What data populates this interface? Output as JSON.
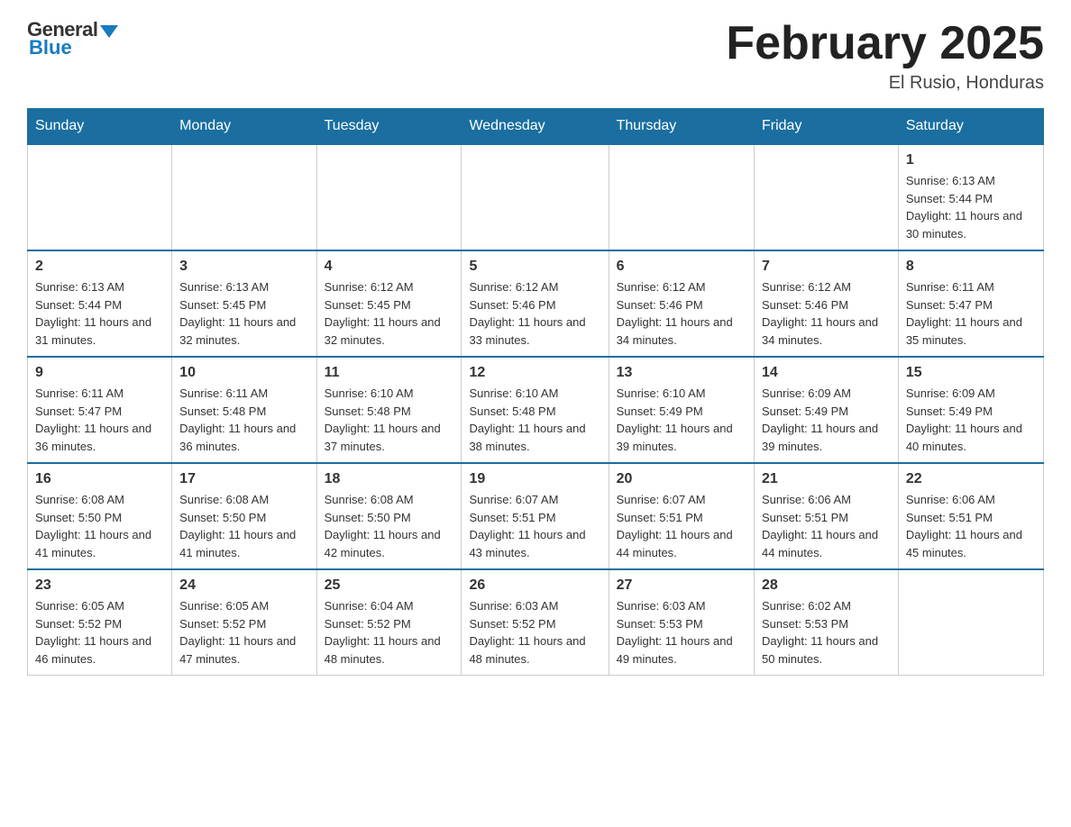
{
  "logo": {
    "general": "General",
    "blue": "Blue"
  },
  "title": "February 2025",
  "location": "El Rusio, Honduras",
  "days_of_week": [
    "Sunday",
    "Monday",
    "Tuesday",
    "Wednesday",
    "Thursday",
    "Friday",
    "Saturday"
  ],
  "weeks": [
    [
      {
        "day": "",
        "info": ""
      },
      {
        "day": "",
        "info": ""
      },
      {
        "day": "",
        "info": ""
      },
      {
        "day": "",
        "info": ""
      },
      {
        "day": "",
        "info": ""
      },
      {
        "day": "",
        "info": ""
      },
      {
        "day": "1",
        "info": "Sunrise: 6:13 AM\nSunset: 5:44 PM\nDaylight: 11 hours and 30 minutes."
      }
    ],
    [
      {
        "day": "2",
        "info": "Sunrise: 6:13 AM\nSunset: 5:44 PM\nDaylight: 11 hours and 31 minutes."
      },
      {
        "day": "3",
        "info": "Sunrise: 6:13 AM\nSunset: 5:45 PM\nDaylight: 11 hours and 32 minutes."
      },
      {
        "day": "4",
        "info": "Sunrise: 6:12 AM\nSunset: 5:45 PM\nDaylight: 11 hours and 32 minutes."
      },
      {
        "day": "5",
        "info": "Sunrise: 6:12 AM\nSunset: 5:46 PM\nDaylight: 11 hours and 33 minutes."
      },
      {
        "day": "6",
        "info": "Sunrise: 6:12 AM\nSunset: 5:46 PM\nDaylight: 11 hours and 34 minutes."
      },
      {
        "day": "7",
        "info": "Sunrise: 6:12 AM\nSunset: 5:46 PM\nDaylight: 11 hours and 34 minutes."
      },
      {
        "day": "8",
        "info": "Sunrise: 6:11 AM\nSunset: 5:47 PM\nDaylight: 11 hours and 35 minutes."
      }
    ],
    [
      {
        "day": "9",
        "info": "Sunrise: 6:11 AM\nSunset: 5:47 PM\nDaylight: 11 hours and 36 minutes."
      },
      {
        "day": "10",
        "info": "Sunrise: 6:11 AM\nSunset: 5:48 PM\nDaylight: 11 hours and 36 minutes."
      },
      {
        "day": "11",
        "info": "Sunrise: 6:10 AM\nSunset: 5:48 PM\nDaylight: 11 hours and 37 minutes."
      },
      {
        "day": "12",
        "info": "Sunrise: 6:10 AM\nSunset: 5:48 PM\nDaylight: 11 hours and 38 minutes."
      },
      {
        "day": "13",
        "info": "Sunrise: 6:10 AM\nSunset: 5:49 PM\nDaylight: 11 hours and 39 minutes."
      },
      {
        "day": "14",
        "info": "Sunrise: 6:09 AM\nSunset: 5:49 PM\nDaylight: 11 hours and 39 minutes."
      },
      {
        "day": "15",
        "info": "Sunrise: 6:09 AM\nSunset: 5:49 PM\nDaylight: 11 hours and 40 minutes."
      }
    ],
    [
      {
        "day": "16",
        "info": "Sunrise: 6:08 AM\nSunset: 5:50 PM\nDaylight: 11 hours and 41 minutes."
      },
      {
        "day": "17",
        "info": "Sunrise: 6:08 AM\nSunset: 5:50 PM\nDaylight: 11 hours and 41 minutes."
      },
      {
        "day": "18",
        "info": "Sunrise: 6:08 AM\nSunset: 5:50 PM\nDaylight: 11 hours and 42 minutes."
      },
      {
        "day": "19",
        "info": "Sunrise: 6:07 AM\nSunset: 5:51 PM\nDaylight: 11 hours and 43 minutes."
      },
      {
        "day": "20",
        "info": "Sunrise: 6:07 AM\nSunset: 5:51 PM\nDaylight: 11 hours and 44 minutes."
      },
      {
        "day": "21",
        "info": "Sunrise: 6:06 AM\nSunset: 5:51 PM\nDaylight: 11 hours and 44 minutes."
      },
      {
        "day": "22",
        "info": "Sunrise: 6:06 AM\nSunset: 5:51 PM\nDaylight: 11 hours and 45 minutes."
      }
    ],
    [
      {
        "day": "23",
        "info": "Sunrise: 6:05 AM\nSunset: 5:52 PM\nDaylight: 11 hours and 46 minutes."
      },
      {
        "day": "24",
        "info": "Sunrise: 6:05 AM\nSunset: 5:52 PM\nDaylight: 11 hours and 47 minutes."
      },
      {
        "day": "25",
        "info": "Sunrise: 6:04 AM\nSunset: 5:52 PM\nDaylight: 11 hours and 48 minutes."
      },
      {
        "day": "26",
        "info": "Sunrise: 6:03 AM\nSunset: 5:52 PM\nDaylight: 11 hours and 48 minutes."
      },
      {
        "day": "27",
        "info": "Sunrise: 6:03 AM\nSunset: 5:53 PM\nDaylight: 11 hours and 49 minutes."
      },
      {
        "day": "28",
        "info": "Sunrise: 6:02 AM\nSunset: 5:53 PM\nDaylight: 11 hours and 50 minutes."
      },
      {
        "day": "",
        "info": ""
      }
    ]
  ]
}
